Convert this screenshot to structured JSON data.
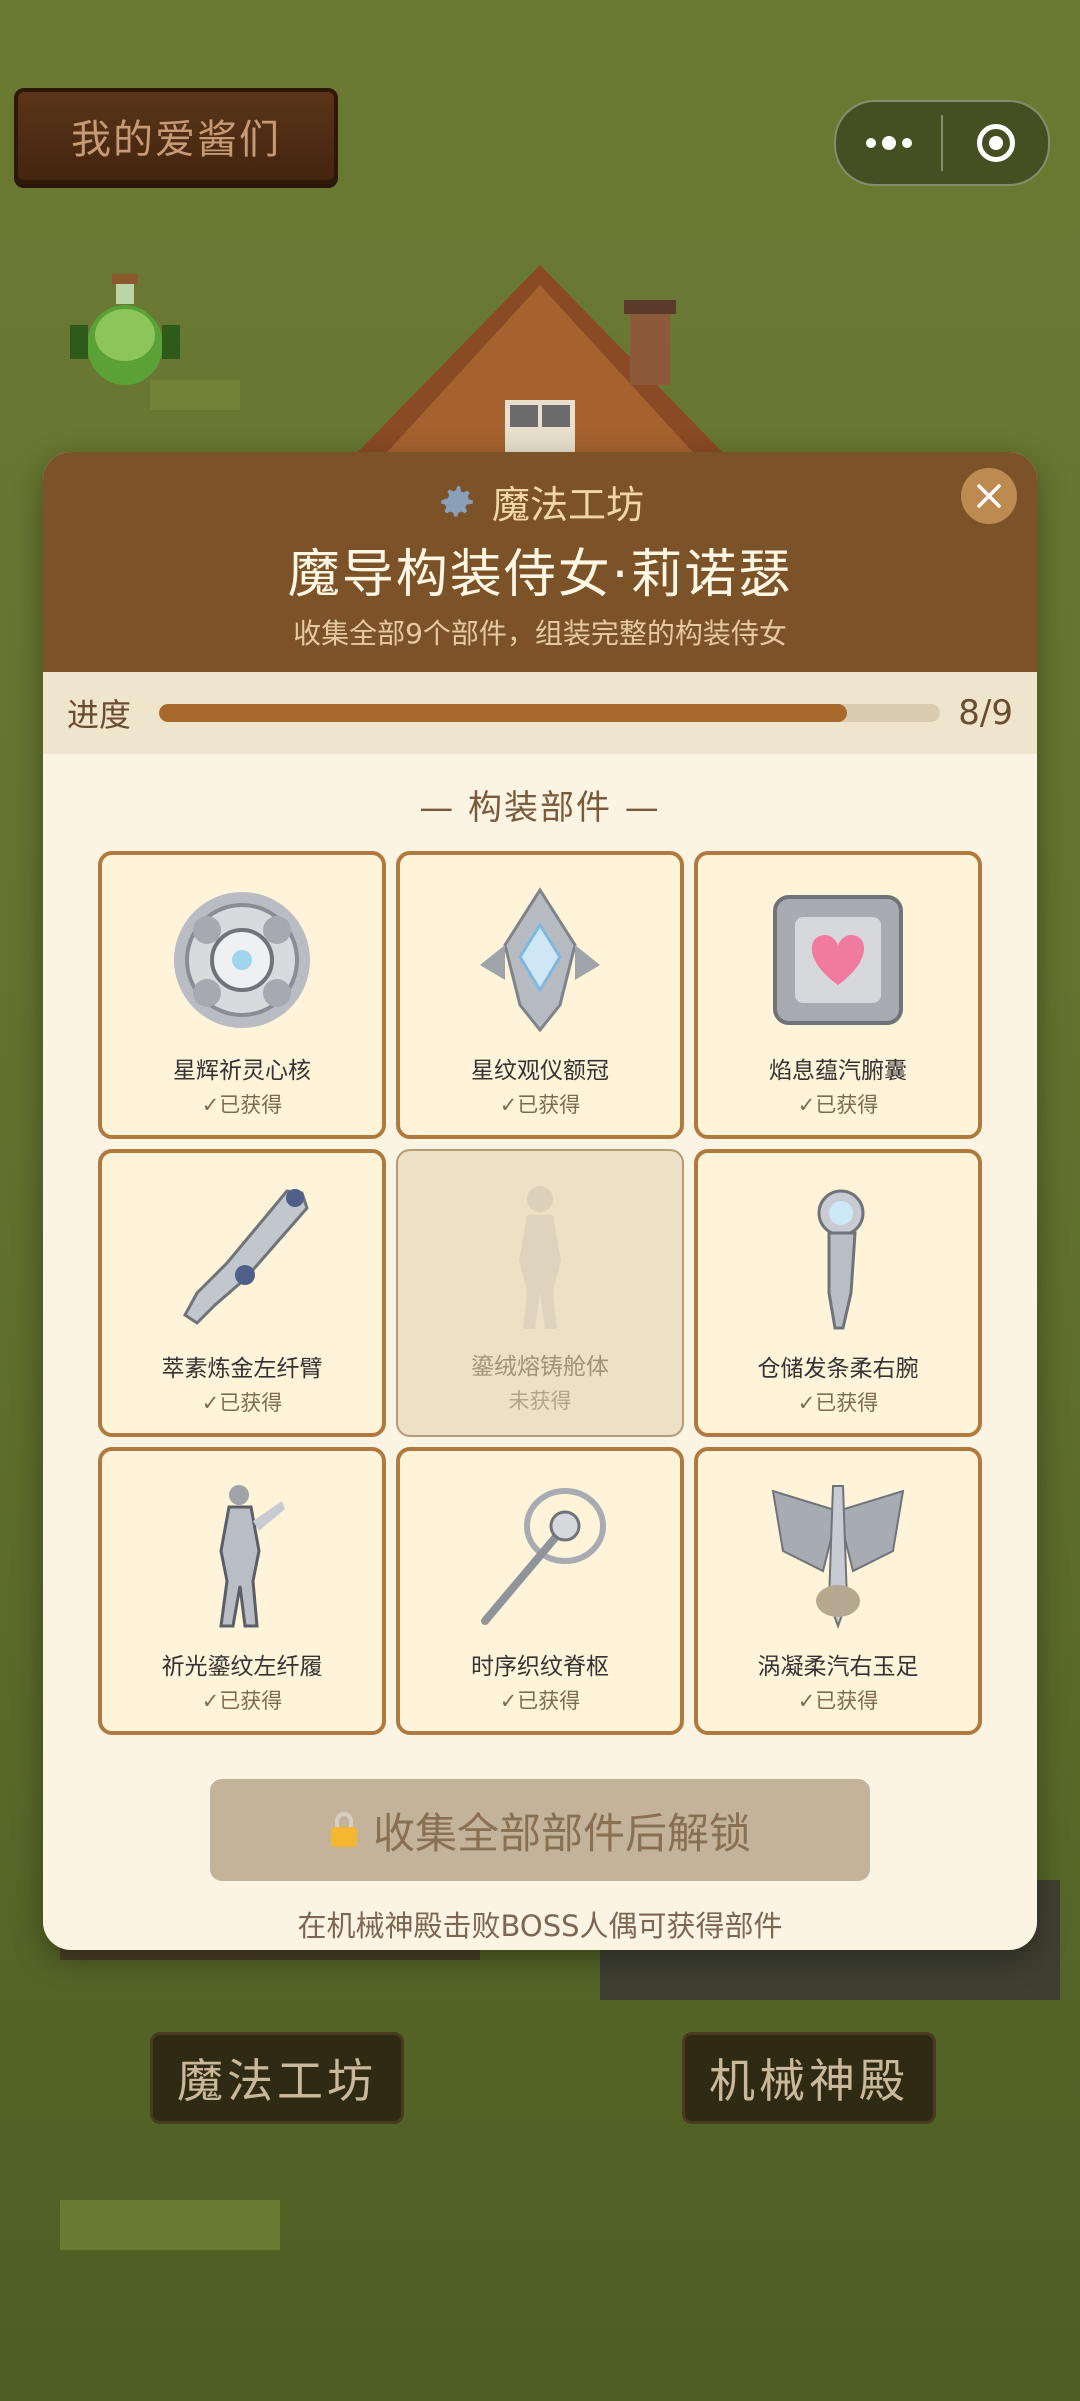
{
  "top_sign": {
    "label": "我的爱酱们"
  },
  "capsule": {
    "more_icon": "more-dots-icon",
    "target_icon": "target-icon"
  },
  "bottom_buttons": {
    "left_label": "魔法工坊",
    "right_label": "机械神殿"
  },
  "modal": {
    "sub_title": "魔法工坊",
    "title": "魔导构装侍女·莉诺瑟",
    "description": "收集全部9个部件，组装完整的构装侍女",
    "progress": {
      "label": "进度",
      "value_text": "8/9",
      "fraction": 0.88
    },
    "section_title": "— 构装部件 —",
    "parts": [
      {
        "name": "星辉祈灵心核",
        "status": "✓已获得",
        "obtained": true,
        "icon": "core-icon"
      },
      {
        "name": "星纹观仪额冠",
        "status": "✓已获得",
        "obtained": true,
        "icon": "crown-icon"
      },
      {
        "name": "焰息蕴汽腑囊",
        "status": "✓已获得",
        "obtained": true,
        "icon": "heart-box-icon"
      },
      {
        "name": "萃素炼金左纤臂",
        "status": "✓已获得",
        "obtained": true,
        "icon": "arm-icon"
      },
      {
        "name": "鎏绒熔铸舱体",
        "status": "未获得",
        "obtained": false,
        "icon": "body-icon"
      },
      {
        "name": "仓储发条柔右腕",
        "status": "✓已获得",
        "obtained": true,
        "icon": "wrist-icon"
      },
      {
        "name": "祈光鎏纹左纤履",
        "status": "✓已获得",
        "obtained": true,
        "icon": "leg-icon"
      },
      {
        "name": "时序织纹脊枢",
        "status": "✓已获得",
        "obtained": true,
        "icon": "spine-icon"
      },
      {
        "name": "涡凝柔汽右玉足",
        "status": "✓已获得",
        "obtained": true,
        "icon": "wing-foot-icon"
      }
    ],
    "unlock_button": "收集全部部件后解锁",
    "hint": "在机械神殿击败BOSS人偶可获得部件"
  }
}
